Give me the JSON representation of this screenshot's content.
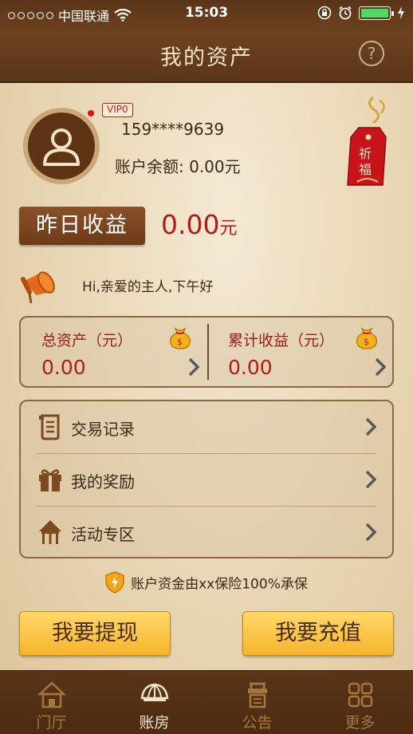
{
  "status_bar": {
    "carrier": "中国联通",
    "time": "15:03"
  },
  "nav": {
    "title": "我的资产",
    "help_icon_text": "?"
  },
  "profile": {
    "vip_badge": "VIP0",
    "phone": "159****9639",
    "balance": "账户余额:  0.00元",
    "tag_text": "祈福"
  },
  "yesterday": {
    "button_label": "昨日收益",
    "value": "0.00",
    "unit": "元"
  },
  "greeting": "Hi,亲爱的主人,下午好",
  "summary": {
    "total_assets_label": "总资产（元）",
    "total_assets_value": "0.00",
    "cumulative_label": "累计收益（元）",
    "cumulative_value": "0.00"
  },
  "menu": {
    "items": [
      {
        "label": "交易记录",
        "icon": "scroll-icon"
      },
      {
        "label": "我的奖励",
        "icon": "gift-icon"
      },
      {
        "label": "活动专区",
        "icon": "pavilion-icon"
      }
    ]
  },
  "insurance_note": "账户资金由xx保险100%承保",
  "actions": {
    "withdraw": "我要提现",
    "recharge": "我要充值"
  },
  "tabbar": {
    "items": [
      {
        "label": "门厅",
        "icon": "house-icon",
        "active": false
      },
      {
        "label": "账房",
        "icon": "umbrella-icon",
        "active": true
      },
      {
        "label": "公告",
        "icon": "notice-icon",
        "active": false
      },
      {
        "label": "更多",
        "icon": "grid-icon",
        "active": false
      }
    ]
  },
  "colors": {
    "header_brown": "#5a3417",
    "accent_red": "#b11b1b",
    "button_gold": "#f5b52c",
    "tab_inactive": "#a5773f",
    "tab_active": "#f1e2c8"
  }
}
